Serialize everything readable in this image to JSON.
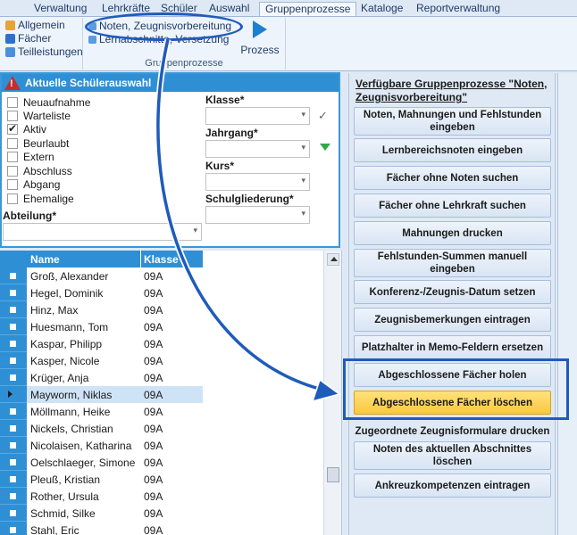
{
  "menubar": {
    "tabs": [
      "Verwaltung",
      "Lehrkräfte",
      "Schüler",
      "Auswahl",
      "Gruppenprozesse",
      "Kataloge",
      "Reportverwaltung"
    ],
    "active_tab": "Gruppenprozesse"
  },
  "ribbon": {
    "left_buttons": [
      "Allgemein",
      "Fächer",
      "Teilleistungen"
    ],
    "group_buttons": [
      "Noten, Zeugnisvorbereitung",
      "Lernabschnitte, Versetzung"
    ],
    "group_label": "Gruppenprozesse",
    "prozess_label": "Prozess"
  },
  "selection": {
    "title": "Aktuelle Schülerauswahl",
    "status_options": [
      {
        "label": "Neuaufnahme",
        "checked": false
      },
      {
        "label": "Warteliste",
        "checked": false
      },
      {
        "label": "Aktiv",
        "checked": true
      },
      {
        "label": "Beurlaubt",
        "checked": false
      },
      {
        "label": "Extern",
        "checked": false
      },
      {
        "label": "Abschluss",
        "checked": false
      },
      {
        "label": "Abgang",
        "checked": false
      },
      {
        "label": "Ehemalige",
        "checked": false
      }
    ],
    "klasse_label": "Klasse*",
    "jahrgang_label": "Jahrgang*",
    "kurs_label": "Kurs*",
    "schulgliederung_label": "Schulgliederung*",
    "abteilung_label": "Abteilung*"
  },
  "grid": {
    "headers": {
      "name": "Name",
      "klasse": "Klasse"
    },
    "rows": [
      {
        "name": "Groß, Alexander",
        "klasse": "09A"
      },
      {
        "name": "Hegel, Dominik",
        "klasse": "09A"
      },
      {
        "name": "Hinz, Max",
        "klasse": "09A"
      },
      {
        "name": "Huesmann, Tom",
        "klasse": "09A"
      },
      {
        "name": "Kaspar, Philipp",
        "klasse": "09A"
      },
      {
        "name": "Kasper, Nicole",
        "klasse": "09A"
      },
      {
        "name": "Krüger, Anja",
        "klasse": "09A"
      },
      {
        "name": "Mayworm, Niklas",
        "klasse": "09A"
      },
      {
        "name": "Möllmann, Heike",
        "klasse": "09A"
      },
      {
        "name": "Nickels, Christian",
        "klasse": "09A"
      },
      {
        "name": "Nicolaisen, Katharina",
        "klasse": "09A"
      },
      {
        "name": "Oelschlaeger, Simone",
        "klasse": "09A"
      },
      {
        "name": "Pleuß, Kristian",
        "klasse": "09A"
      },
      {
        "name": "Rother, Ursula",
        "klasse": "09A"
      },
      {
        "name": "Schmid, Silke",
        "klasse": "09A"
      },
      {
        "name": "Stahl, Eric",
        "klasse": "09A"
      }
    ],
    "current_row": "Mayworm, Niklas"
  },
  "processes": {
    "title": "Verfügbare Gruppenprozesse \"Noten, Zeugnisvorbereitung\"",
    "buttons": [
      "Noten, Mahnungen und Fehlstunden eingeben",
      "Lernbereichsnoten eingeben",
      "Fächer ohne Noten suchen",
      "Fächer ohne Lehrkraft suchen",
      "Mahnungen drucken",
      "Fehlstunden-Summen manuell eingeben",
      "Konferenz-/Zeugnis-Datum setzen",
      "Zeugnisbemerkungen eintragen",
      "Platzhalter in Memo-Feldern ersetzen",
      "Abgeschlossene Fächer holen",
      "Abgeschlossene Fächer löschen"
    ],
    "active_button": "Abgeschlossene Fächer löschen",
    "partial_item": "Zugeordnete Zeugnisformulare drucken",
    "extra_buttons": [
      "Noten des aktuellen Abschnittes löschen",
      "Ankreuzkompetenzen eintragen"
    ]
  },
  "colors": {
    "accent_blue": "#2e8fd5",
    "highlight_yellow": "#f9c93f",
    "annotation_blue": "#1f5bbb",
    "warning_red": "#c52d2d"
  }
}
